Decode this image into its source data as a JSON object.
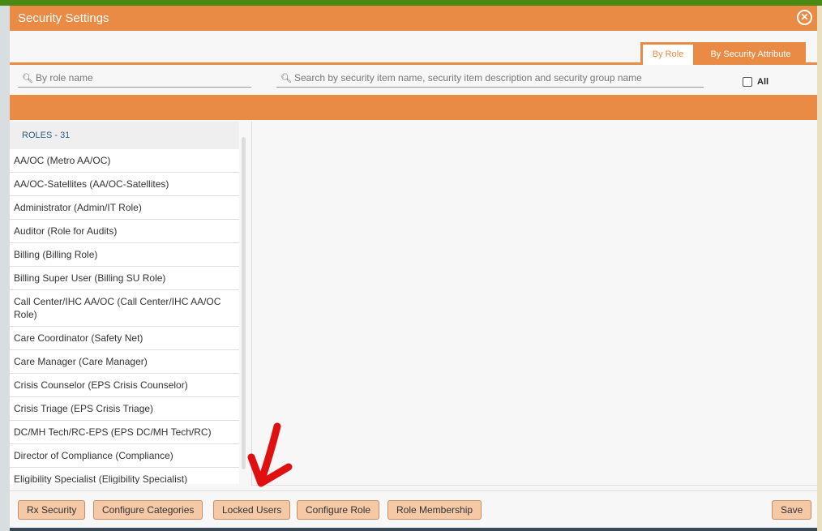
{
  "dialog": {
    "title": "Security Settings",
    "close_icon": "close-circle-icon"
  },
  "tabs": [
    {
      "label": "By Role",
      "active": true
    },
    {
      "label": "By Security Attribute",
      "active": false
    }
  ],
  "search": {
    "role_placeholder": "By role name",
    "item_placeholder": "Search by security item name, security item description and security group name",
    "all_label": "All",
    "all_checked": false
  },
  "roles": {
    "header": "ROLES - 31",
    "items": [
      "AA/OC (Metro AA/OC)",
      "AA/OC-Satellites (AA/OC-Satellites)",
      "Administrator (Admin/IT Role)",
      "Auditor (Role for Audits)",
      "Billing (Billing Role)",
      "Billing Super User (Billing SU Role)",
      "Call Center/IHC AA/OC (Call Center/IHC AA/OC Role)",
      "Care Coordinator (Safety Net)",
      "Care Manager (Care Manager)",
      "Crisis Counselor (EPS Crisis Counselor)",
      "Crisis Triage (EPS Crisis Triage)",
      "DC/MH Tech/RC-EPS (EPS DC/MH Tech/RC)",
      "Director of Compliance (Compliance)",
      "Eligibility Specialist (Eligibility Specialist)"
    ]
  },
  "footer": {
    "buttons": [
      "Rx Security",
      "Configure Categories",
      "Locked Users",
      "Configure Role",
      "Role Membership"
    ],
    "save": "Save"
  },
  "colors": {
    "accent": "#e98a45",
    "button": "#f5c8a6",
    "annotation": "#e01010"
  }
}
